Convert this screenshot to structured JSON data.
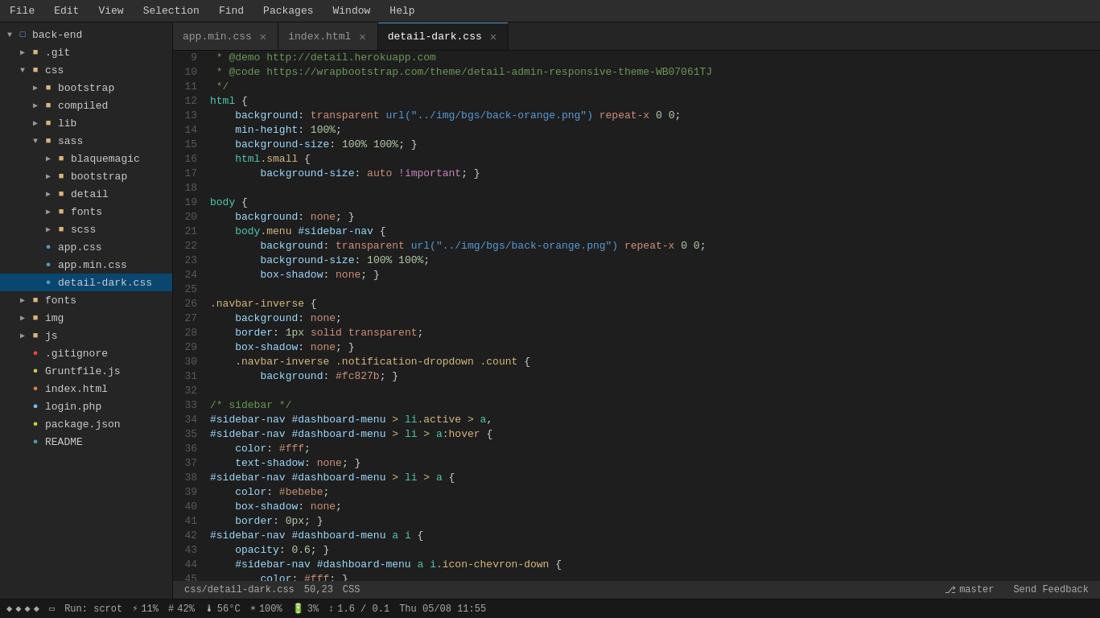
{
  "menubar": {
    "items": [
      "File",
      "Edit",
      "View",
      "Selection",
      "Find",
      "Packages",
      "Window",
      "Help"
    ]
  },
  "tabs": [
    {
      "id": "tab-app-min-css",
      "label": "app.min.css",
      "active": false
    },
    {
      "id": "tab-index-html",
      "label": "index.html",
      "active": false
    },
    {
      "id": "tab-detail-dark-css",
      "label": "detail-dark.css",
      "active": true
    }
  ],
  "sidebar": {
    "root_label": "back-end",
    "items": [
      {
        "type": "folder",
        "label": ".git",
        "indent": 1,
        "expanded": false
      },
      {
        "type": "folder",
        "label": "css",
        "indent": 1,
        "expanded": true
      },
      {
        "type": "folder",
        "label": "bootstrap",
        "indent": 2,
        "expanded": false
      },
      {
        "type": "folder",
        "label": "compiled",
        "indent": 2,
        "expanded": false
      },
      {
        "type": "folder",
        "label": "lib",
        "indent": 2,
        "expanded": false
      },
      {
        "type": "folder",
        "label": "sass",
        "indent": 2,
        "expanded": true
      },
      {
        "type": "folder",
        "label": "blaquemagic",
        "indent": 3,
        "expanded": false
      },
      {
        "type": "folder",
        "label": "bootstrap",
        "indent": 3,
        "expanded": false
      },
      {
        "type": "folder",
        "label": "detail",
        "indent": 3,
        "expanded": false
      },
      {
        "type": "folder",
        "label": "fonts",
        "indent": 3,
        "expanded": false
      },
      {
        "type": "folder",
        "label": "scss",
        "indent": 3,
        "expanded": false
      },
      {
        "type": "file",
        "label": "app.css",
        "indent": 2,
        "ext": "css"
      },
      {
        "type": "file",
        "label": "app.min.css",
        "indent": 2,
        "ext": "css"
      },
      {
        "type": "file",
        "label": "detail-dark.css",
        "indent": 2,
        "ext": "css",
        "selected": true
      },
      {
        "type": "folder",
        "label": "fonts",
        "indent": 1,
        "expanded": false
      },
      {
        "type": "folder",
        "label": "img",
        "indent": 1,
        "expanded": false
      },
      {
        "type": "folder",
        "label": "js",
        "indent": 1,
        "expanded": false
      },
      {
        "type": "file",
        "label": ".gitignore",
        "indent": 1,
        "ext": "git"
      },
      {
        "type": "file",
        "label": "Gruntfile.js",
        "indent": 1,
        "ext": "js"
      },
      {
        "type": "file",
        "label": "index.html",
        "indent": 1,
        "ext": "html"
      },
      {
        "type": "file",
        "label": "login.php",
        "indent": 1,
        "ext": "php"
      },
      {
        "type": "file",
        "label": "package.json",
        "indent": 1,
        "ext": "json"
      },
      {
        "type": "file",
        "label": "README",
        "indent": 1,
        "ext": "md"
      }
    ]
  },
  "editor": {
    "filename": "detail-dark.css",
    "filepath": "css/detail-dark.css",
    "cursor": "50,23",
    "language": "CSS"
  },
  "statusbar": {
    "branch": "master",
    "feedback": "Send Feedback",
    "run": "Run: scrot",
    "percent1": "11%",
    "percent2": "42%",
    "temp": "56°C",
    "brightness": "100%",
    "battery": "3%",
    "network": "1.6 / 0.1",
    "datetime": "Thu 05/08 11:55"
  }
}
